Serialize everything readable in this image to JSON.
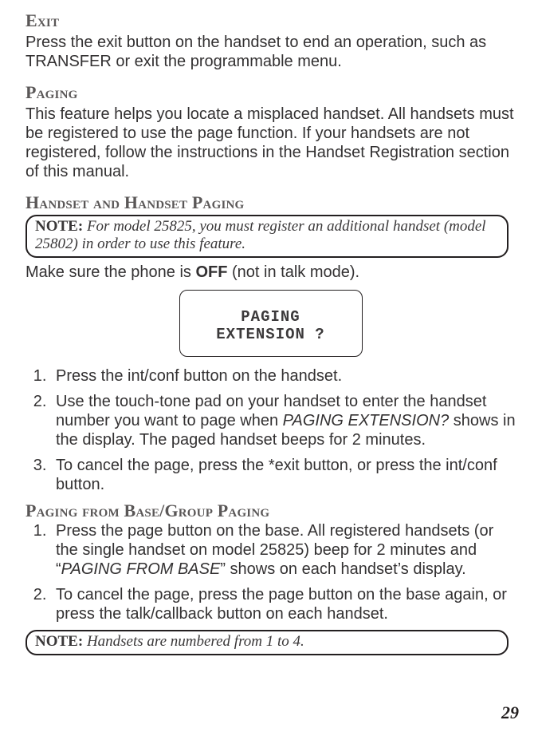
{
  "sections": {
    "exit": {
      "heading": "Exit",
      "body": "Press the exit button on the handset to end an operation, such as TRANSFER or exit the programmable menu."
    },
    "paging": {
      "heading": "Paging",
      "body": "This feature helps you locate a misplaced handset. All handsets must be registered to use the page function. If your handsets are not registered, follow the instructions in the Handset Registration section of this manual."
    },
    "handset_paging": {
      "heading": "Handset and Handset Paging",
      "note_label": "NOTE:",
      "note_text": " For model 25825, you must register an additional handset (model 25802) in order to use this feature.",
      "off_pre": "Make sure the phone is ",
      "off_bold": "OFF",
      "off_post": " (not in talk mode).",
      "lcd_line1": "PAGING",
      "lcd_line2": "EXTENSION ?",
      "step1": "Press the int/conf button on the handset.",
      "step2_pre": "Use the touch-tone pad on your handset to enter the handset number you want to page when ",
      "step2_ital": "PAGING EXTENSION?",
      "step2_post": " shows in the display. The paged handset beeps for 2 minutes.",
      "step3": "To cancel the page, press the *exit button, or press the int/conf button."
    },
    "base_paging": {
      "heading": "Paging from Base/Group Paging",
      "step1_pre": "Press the page button on the base. All registered handsets (or the single handset on model 25825) beep for 2 minutes and “",
      "step1_ital": "PAGING FROM BASE",
      "step1_post": "” shows on each handset’s display.",
      "step2": "To cancel the page, press the page button on the base again, or press the talk/callback button on each handset.",
      "note_label": "NOTE:",
      "note_text": " Handsets are numbered from 1 to 4."
    }
  },
  "page_number": "29"
}
